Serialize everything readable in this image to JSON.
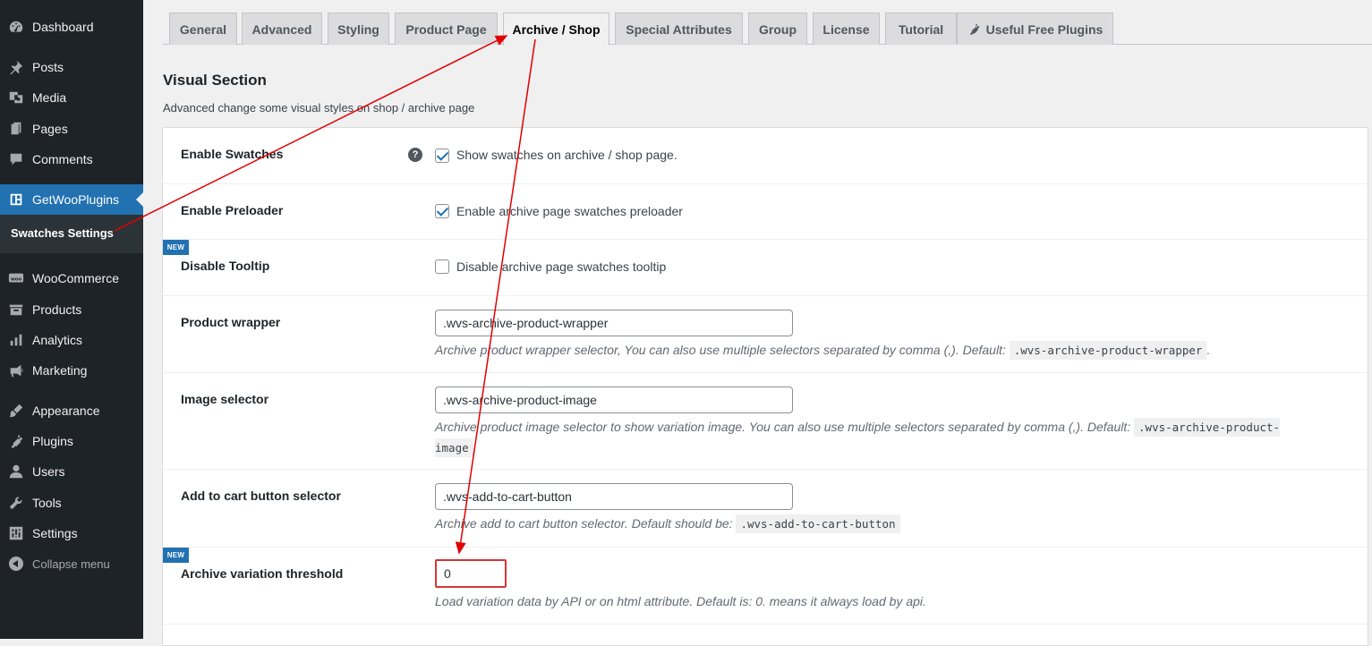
{
  "sidebar": {
    "items": [
      {
        "label": "Dashboard",
        "icon": "dashboard-icon"
      },
      {
        "label": "Posts",
        "icon": "pin-icon"
      },
      {
        "label": "Media",
        "icon": "media-icon"
      },
      {
        "label": "Pages",
        "icon": "pages-icon"
      },
      {
        "label": "Comments",
        "icon": "comments-icon"
      },
      {
        "label": "GetWooPlugins",
        "icon": "getwooplugins-icon",
        "active": true
      },
      {
        "label": "WooCommerce",
        "icon": "woocommerce-icon"
      },
      {
        "label": "Products",
        "icon": "products-icon"
      },
      {
        "label": "Analytics",
        "icon": "analytics-icon"
      },
      {
        "label": "Marketing",
        "icon": "marketing-icon"
      },
      {
        "label": "Appearance",
        "icon": "appearance-icon"
      },
      {
        "label": "Plugins",
        "icon": "plugins-icon"
      },
      {
        "label": "Users",
        "icon": "users-icon"
      },
      {
        "label": "Tools",
        "icon": "tools-icon"
      },
      {
        "label": "Settings",
        "icon": "settings-icon"
      }
    ],
    "submenu_label": "Swatches Settings",
    "collapse_label": "Collapse menu"
  },
  "tabs": [
    {
      "label": "General"
    },
    {
      "label": "Advanced"
    },
    {
      "label": "Styling"
    },
    {
      "label": "Product Page"
    },
    {
      "label": "Archive / Shop",
      "active": true
    },
    {
      "label": "Special Attributes"
    },
    {
      "label": "Group"
    },
    {
      "label": "License"
    },
    {
      "label": "Tutorial"
    },
    {
      "label": "Useful Free Plugins",
      "icon": "plug-icon"
    }
  ],
  "section": {
    "title": "Visual Section",
    "description": "Advanced change some visual styles on shop / archive page"
  },
  "settings": {
    "new_badge": "NEW",
    "help_icon_glyph": "?",
    "enable_swatches": {
      "label": "Enable Swatches",
      "checkbox_label": "Show swatches on archive / shop page.",
      "checked": true
    },
    "enable_preloader": {
      "label": "Enable Preloader",
      "checkbox_label": "Enable archive page swatches preloader",
      "checked": true
    },
    "disable_tooltip": {
      "label": "Disable Tooltip",
      "checkbox_label": "Disable archive page swatches tooltip",
      "checked": false
    },
    "product_wrapper": {
      "label": "Product wrapper",
      "value": ".wvs-archive-product-wrapper",
      "desc_text": "Archive product wrapper selector, You can also use multiple selectors separated by comma (,). Default: ",
      "desc_code": ".wvs-archive-product-wrapper",
      "desc_tail": "."
    },
    "image_selector": {
      "label": "Image selector",
      "value": ".wvs-archive-product-image",
      "desc_text": "Archive product image selector to show variation image. You can also use multiple selectors separated by comma (,). Default: ",
      "desc_code": ".wvs-archive-product-image",
      "desc_tail": "."
    },
    "add_to_cart": {
      "label": "Add to cart button selector",
      "value": ".wvs-add-to-cart-button",
      "desc_text": "Archive add to cart button selector. Default should be: ",
      "desc_code": ".wvs-add-to-cart-button"
    },
    "variation_threshold": {
      "label": "Archive variation threshold",
      "value": "0",
      "description": "Load variation data by API or on html attribute. Default is: 0. means it always load by api."
    }
  },
  "annotation_color": "#e00000"
}
